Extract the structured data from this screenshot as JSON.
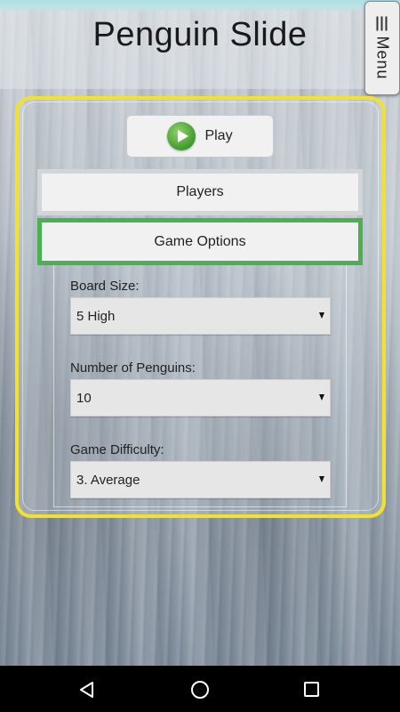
{
  "app": {
    "title": "Penguin Slide"
  },
  "menu": {
    "label": "Menu"
  },
  "actions": {
    "play_label": "Play"
  },
  "tabs": {
    "players_label": "Players",
    "game_options_label": "Game Options"
  },
  "options": {
    "board_size": {
      "label": "Board Size:",
      "value": "5 High"
    },
    "num_penguins": {
      "label": "Number of Penguins:",
      "value": "10"
    },
    "difficulty": {
      "label": "Game Difficulty:",
      "value": "3. Average"
    }
  },
  "colors": {
    "panel_border": "#f2e22c",
    "selected_tab": "#4caf50"
  },
  "icons": [
    "hamburger-icon",
    "play-icon",
    "dropdown-caret-icon",
    "nav-back-icon",
    "nav-home-icon",
    "nav-recents-icon"
  ]
}
